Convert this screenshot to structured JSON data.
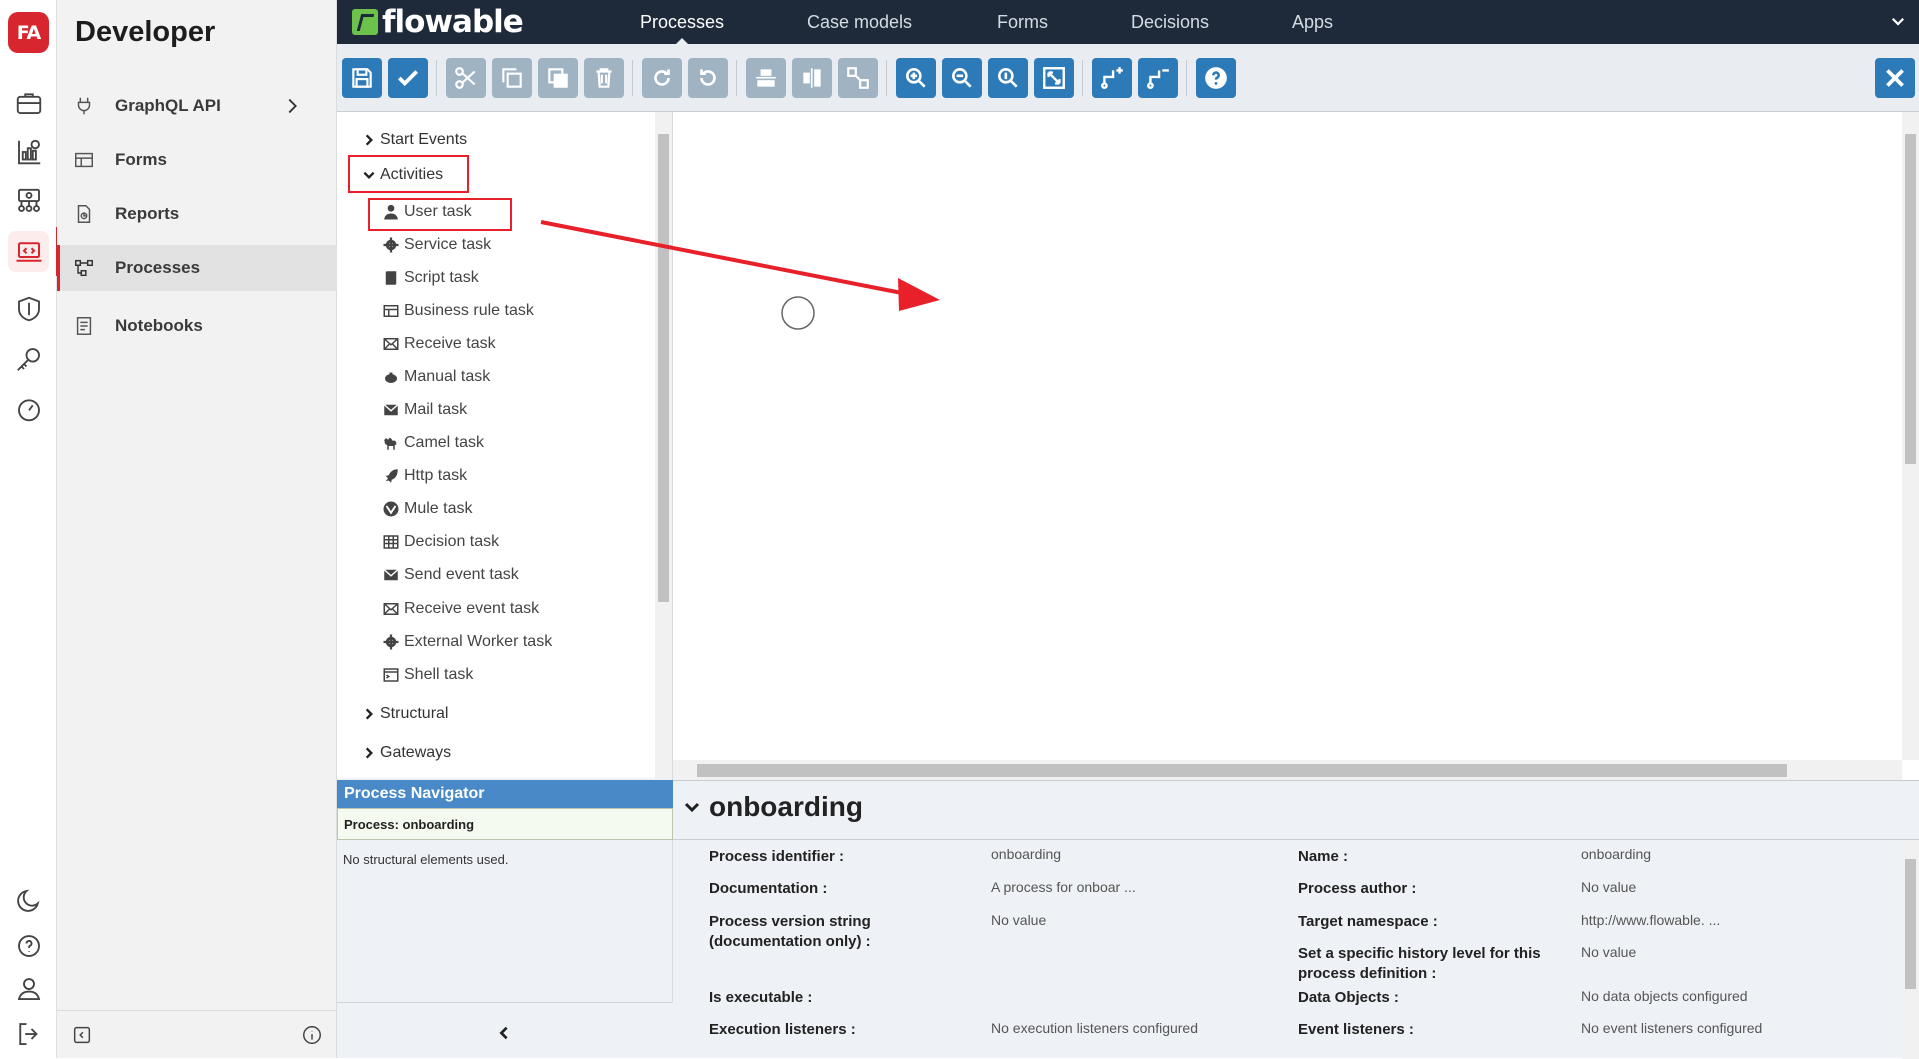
{
  "rail": {
    "logo": "FA",
    "icons": [
      "briefcase-icon",
      "dashboard-icon",
      "network-icon",
      "developer-icon",
      "shield-icon",
      "key-icon",
      "speedometer-icon",
      "moon-icon",
      "help-icon",
      "user-icon",
      "logout-icon"
    ]
  },
  "sidebar": {
    "title": "Developer",
    "items": [
      {
        "label": "GraphQL API",
        "icon": "plug-icon"
      },
      {
        "label": "Forms",
        "icon": "table-icon"
      },
      {
        "label": "Reports",
        "icon": "report-icon"
      },
      {
        "label": "Processes",
        "icon": "process-icon"
      },
      {
        "label": "Notebooks",
        "icon": "notebook-icon"
      }
    ]
  },
  "topnav": {
    "brand": "flowable",
    "tabs": [
      "Processes",
      "Case models",
      "Forms",
      "Decisions",
      "Apps"
    ],
    "active_tab": "Processes"
  },
  "palette": {
    "groups": {
      "start_events": "Start Events",
      "activities": "Activities",
      "structural": "Structural",
      "gateways": "Gateways"
    },
    "activities": [
      {
        "label": "User task",
        "icon": "user-icon"
      },
      {
        "label": "Service task",
        "icon": "gear-icon"
      },
      {
        "label": "Script task",
        "icon": "script-icon"
      },
      {
        "label": "Business rule task",
        "icon": "table-icon"
      },
      {
        "label": "Receive task",
        "icon": "envelope-icon"
      },
      {
        "label": "Manual task",
        "icon": "hand-icon"
      },
      {
        "label": "Mail task",
        "icon": "mail-icon"
      },
      {
        "label": "Camel task",
        "icon": "camel-icon"
      },
      {
        "label": "Http task",
        "icon": "rocket-icon"
      },
      {
        "label": "Mule task",
        "icon": "mule-icon"
      },
      {
        "label": "Decision task",
        "icon": "grid-icon"
      },
      {
        "label": "Send event task",
        "icon": "send-icon"
      },
      {
        "label": "Receive event task",
        "icon": "envelope-icon"
      },
      {
        "label": "External Worker task",
        "icon": "gear-icon"
      },
      {
        "label": "Shell task",
        "icon": "terminal-icon"
      }
    ]
  },
  "navigator": {
    "title": "Process Navigator",
    "process": "Process: onboarding",
    "empty": "No structural elements used."
  },
  "properties": {
    "title": "onboarding",
    "left": [
      {
        "label": "Process identifier :",
        "value": "onboarding"
      },
      {
        "label": "Documentation :",
        "value": "A process for onboar ..."
      },
      {
        "label": "Process version string (documentation only) :",
        "value": "No value"
      },
      {
        "label": "Is executable :",
        "value": ""
      },
      {
        "label": "Execution listeners :",
        "value": "No execution listeners configured"
      }
    ],
    "right": [
      {
        "label": "Name :",
        "value": "onboarding"
      },
      {
        "label": "Process author :",
        "value": "No value"
      },
      {
        "label": "Target namespace :",
        "value": "http://www.flowable. ..."
      },
      {
        "label": "Set a specific history level for this process definition :",
        "value": "No value"
      },
      {
        "label": "Data Objects :",
        "value": "No data objects configured"
      },
      {
        "label": "Event listeners :",
        "value": "No event listeners configured"
      }
    ]
  },
  "colors": {
    "accent_red": "#d7262e",
    "nav_bg": "#1e2a3a",
    "button_blue": "#2d7ab8",
    "annotation_red": "#e8202a",
    "navigator_blue": "#4a89c7"
  }
}
